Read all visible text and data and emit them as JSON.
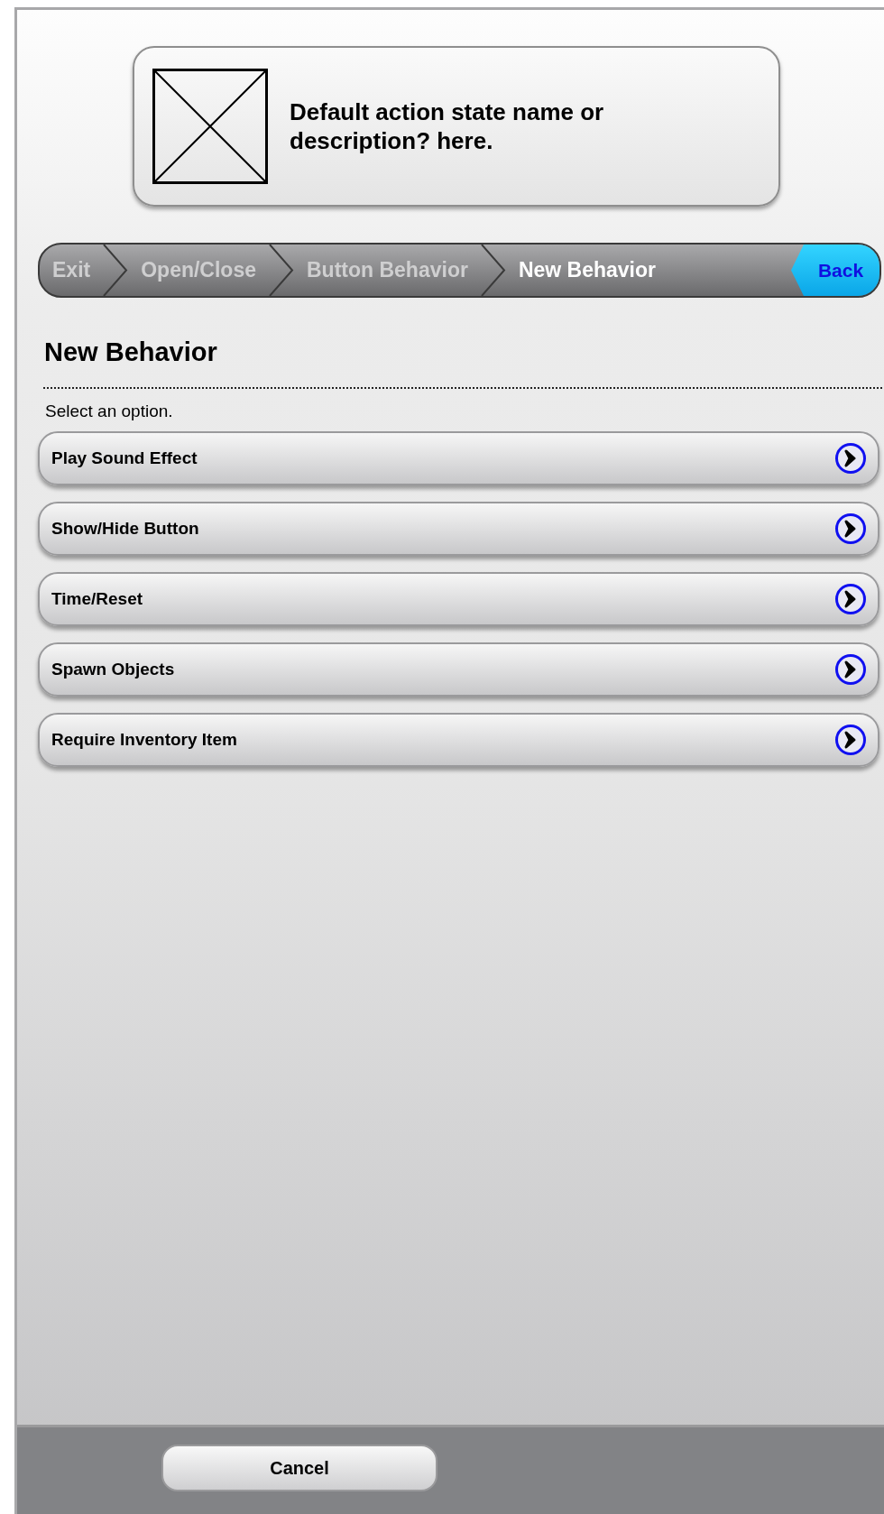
{
  "header_card": {
    "image": {
      "kind": "placeholder"
    },
    "text": "Default action state name or description? here."
  },
  "breadcrumb": [
    {
      "label": "Exit",
      "selected": false
    },
    {
      "label": "Open/Close",
      "selected": false
    },
    {
      "label": "Button Behavior",
      "selected": false
    },
    {
      "label": "New Behavior",
      "selected": true
    }
  ],
  "back_button": "Back",
  "title": "New Behavior",
  "instruction": "Select an option.",
  "options": [
    {
      "label": "Play Sound Effect"
    },
    {
      "label": "Show/Hide Button"
    },
    {
      "label": "Time/Reset"
    },
    {
      "label": "Spawn Objects"
    },
    {
      "label": "Require Inventory Item"
    }
  ],
  "footer": {
    "cancel_button": "Cancel"
  }
}
